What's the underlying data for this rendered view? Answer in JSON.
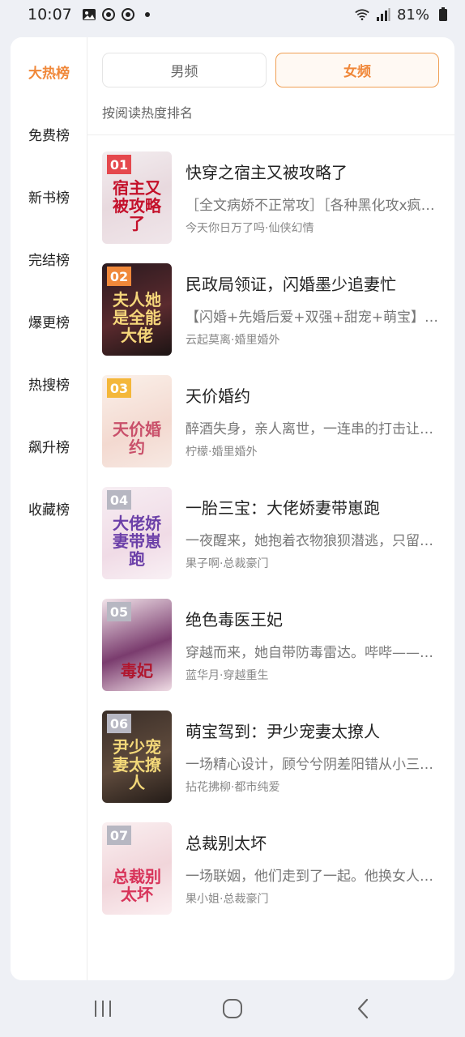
{
  "status_bar": {
    "time": "10:07",
    "battery": "81%",
    "icons": [
      "image-icon",
      "sync-icon",
      "sync-icon",
      "dot-icon"
    ],
    "right_icons": [
      "wifi-icon",
      "signal-icon",
      "battery-icon"
    ]
  },
  "colors": {
    "accent": "#f0883a",
    "page_bg": "#eef0f5",
    "card_bg": "#ffffff"
  },
  "left_nav": {
    "items": [
      {
        "label": "大热榜",
        "active": true
      },
      {
        "label": "免费榜",
        "active": false
      },
      {
        "label": "新书榜",
        "active": false
      },
      {
        "label": "完结榜",
        "active": false
      },
      {
        "label": "爆更榜",
        "active": false
      },
      {
        "label": "热搜榜",
        "active": false
      },
      {
        "label": "飙升榜",
        "active": false
      },
      {
        "label": "收藏榜",
        "active": false
      }
    ]
  },
  "tabs": {
    "male": "男频",
    "female": "女频",
    "selected": "女频"
  },
  "subtitle": "按阅读热度排名",
  "books": [
    {
      "rank": "01",
      "title": "快穿之宿主又被攻略了",
      "desc": "［全文病娇不正常攻］［各种黑化攻x疯批美人受］",
      "meta": "今天你日万了吗·仙侠幻情",
      "cover_title": "宿主又被攻略了"
    },
    {
      "rank": "02",
      "title": "民政局领证，闪婚墨少追妻忙",
      "desc": "【闪婚+先婚后爱+双强+甜宠+萌宝】全能大佬",
      "meta": "云起莫离·婚里婚外",
      "cover_title": "夫人她是全能大佬"
    },
    {
      "rank": "03",
      "title": "天价婚约",
      "desc": "醉酒失身，亲人离世，一连串的打击让她身心俱疲",
      "meta": "柠檬·婚里婚外",
      "cover_title": "天价婚约"
    },
    {
      "rank": "04",
      "title": "一胎三宝：大佬娇妻带崽跑",
      "desc": "一夜醒来，她抱着衣物狼狈潜逃，只留下一串钱",
      "meta": "果子啊·总裁豪门",
      "cover_title": "大佬娇妻带崽跑"
    },
    {
      "rank": "05",
      "title": "绝色毒医王妃",
      "desc": "穿越而来，她自带防毒雷达。哔哔——有毒！",
      "meta": "蓝华月·穿越重生",
      "cover_title": "毒妃"
    },
    {
      "rank": "06",
      "title": "萌宝驾到：尹少宠妻太撩人",
      "desc": "一场精心设计，顾兮兮阴差阳错从小三变成新娘",
      "meta": "拈花拂柳·都市纯爱",
      "cover_title": "尹少宠妻太撩人"
    },
    {
      "rank": "07",
      "title": "总裁别太坏",
      "desc": "一场联姻，他们走到了一起。他换女人如换衣服",
      "meta": "果小姐·总裁豪门",
      "cover_title": "总裁别太坏"
    }
  ],
  "nav_bar": {
    "recent": "recent-apps-icon",
    "home": "home-icon",
    "back": "back-icon"
  }
}
